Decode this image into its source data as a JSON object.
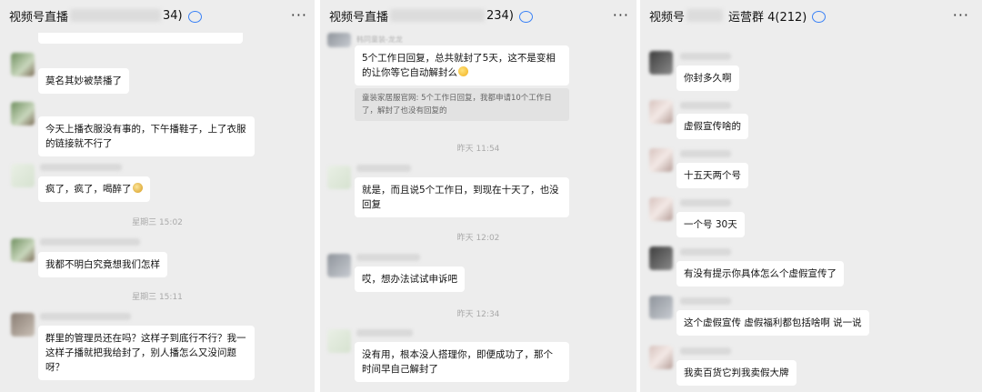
{
  "panels": [
    {
      "header": {
        "title_prefix": "视频号直播",
        "title_suffix": "34)"
      },
      "messages": [
        {
          "text": "莫名其妙被禁播了"
        },
        {
          "text": "今天上播衣服没有事的，下午播鞋子，上了衣服的链接就不行了"
        },
        {
          "text": "疯了，疯了，喝醉了",
          "emoji": "money-face-emoji"
        },
        {
          "text": "我都不明白究竟想我们怎样"
        },
        {
          "text": "群里的管理员还在吗？这样子到底行不行？我一这样子播就把我给封了，别人播怎么又没问题呀？"
        }
      ],
      "timestamps": [
        "星期三 15:02",
        "星期三 15:11"
      ]
    },
    {
      "header": {
        "title_prefix": "视频号直播",
        "title_suffix": "234)"
      },
      "messages": [
        {
          "text": "5个工作日回复，总共就封了5天，这不是变相的让你等它自动解封么",
          "emoji": "grin-sweat-emoji"
        },
        {
          "text": "就是，而且说5个工作日，到现在十天了，也没回复"
        },
        {
          "text": "哎，想办法试试申诉吧"
        },
        {
          "text": "没有用，根本没人搭理你，即便成功了，那个时间早自己解封了"
        }
      ],
      "quote": "童装家居服官网: 5个工作日回复，我都申请10个工作日了，解封了也没有回复的",
      "quote_sender": "韩同童装-龙龙",
      "timestamps": [
        "昨天 11:54",
        "昨天 12:02",
        "昨天 12:34"
      ]
    },
    {
      "header": {
        "title_prefix": "视频号",
        "title_suffix": "运营群 4(212)"
      },
      "messages": [
        {
          "text": "你封多久啊"
        },
        {
          "text": "虚假宣传啥的"
        },
        {
          "text": "十五天两个号"
        },
        {
          "text": "一个号 30天"
        },
        {
          "text": "有没有提示你具体怎么个虚假宣传了"
        },
        {
          "text": "这个虚假宣传 虚假福利都包括啥啊 说一说"
        },
        {
          "text": "我卖百货它判我卖假大牌"
        }
      ]
    }
  ],
  "icons": {
    "chat": "chat-bubble-icon",
    "more": "more-dots-icon"
  },
  "more_label": "···"
}
